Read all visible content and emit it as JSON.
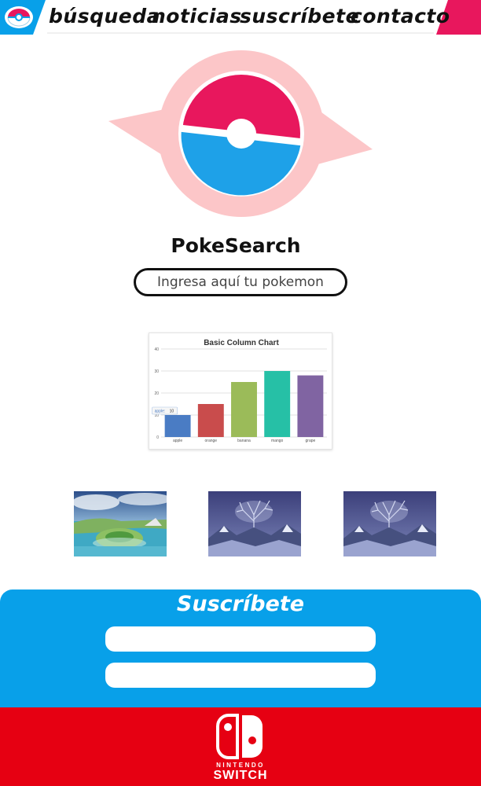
{
  "nav": {
    "logo_icon": "pokeball-logo-icon",
    "links": [
      {
        "label": "búsqueda"
      },
      {
        "label": "noticias"
      },
      {
        "label": "suscríbete"
      },
      {
        "label": "contacto"
      }
    ]
  },
  "hero": {
    "logo_icon": "pokesearch-pokeball-logo",
    "title": "PokeSearch",
    "search": {
      "placeholder": "Ingresa aquí tu pokemon",
      "value": ""
    }
  },
  "chart_data": {
    "type": "bar",
    "title": "Basic Column Chart",
    "xlabel": "",
    "ylabel": "",
    "categories": [
      "apple",
      "orange",
      "banana",
      "mango",
      "grape"
    ],
    "values": [
      10,
      15,
      25,
      30,
      28
    ],
    "colors": [
      "#4a7cc4",
      "#c94c4c",
      "#9bbb59",
      "#26c0a6",
      "#8064a2"
    ],
    "ylim": [
      0,
      40
    ],
    "yticks": [
      0,
      10,
      20,
      30,
      40
    ],
    "grid": true,
    "tooltip": {
      "label": "apple",
      "value": "10"
    }
  },
  "gallery": [
    {
      "icon": "galar-island-landscape-image"
    },
    {
      "icon": "crown-tundra-tree-image"
    },
    {
      "icon": "crown-tundra-tree-image"
    }
  ],
  "subscribe": {
    "title": "Suscríbete",
    "fields": [
      {
        "placeholder": "",
        "value": ""
      },
      {
        "placeholder": "",
        "value": ""
      }
    ]
  },
  "footer": {
    "logo_icon": "nintendo-switch-logo",
    "brand_line1": "NINTENDO",
    "brand_line2": "SWITCH"
  },
  "colors": {
    "nav_blue": "#08a0e9",
    "nav_pink": "#e8175d",
    "pokeball_pink": "#e8175d",
    "pokeball_blue": "#1ea1e8",
    "aura_pink": "#fcc6c8",
    "subscribe_blue": "#08a0e9",
    "footer_red": "#e60012"
  }
}
